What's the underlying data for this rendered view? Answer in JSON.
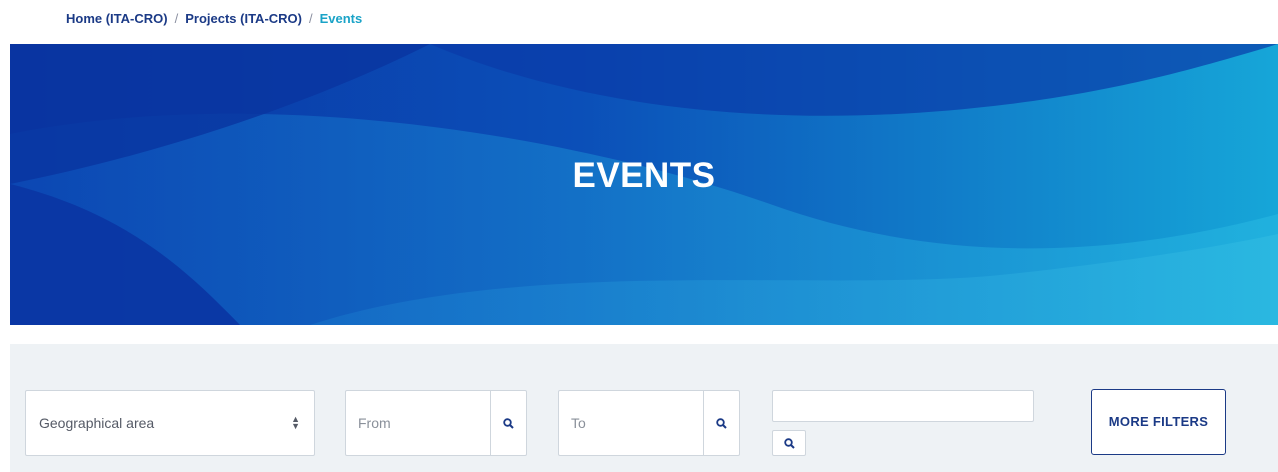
{
  "breadcrumb": {
    "items": [
      "Home (ITA-CRO)",
      "Projects (ITA-CRO)"
    ],
    "separator": "/",
    "current": "Events"
  },
  "hero": {
    "title": "EVENTS"
  },
  "filters": {
    "geographical_area": {
      "selected": "Geographical area",
      "icon": "sort-arrows-icon"
    },
    "from": {
      "placeholder": "From",
      "icon": "search-icon"
    },
    "to": {
      "placeholder": "To",
      "icon": "search-icon"
    },
    "text_search": {
      "value": "",
      "icon": "search-icon"
    },
    "more_filters_label": "MORE FILTERS"
  },
  "colors": {
    "brand_navy": "#1b3a86",
    "accent_cyan": "#1aa3c7",
    "hero_deep_blue": "#0a3aa8",
    "hero_light_blue": "#1aa8d6",
    "filter_bg": "#eef2f5"
  }
}
